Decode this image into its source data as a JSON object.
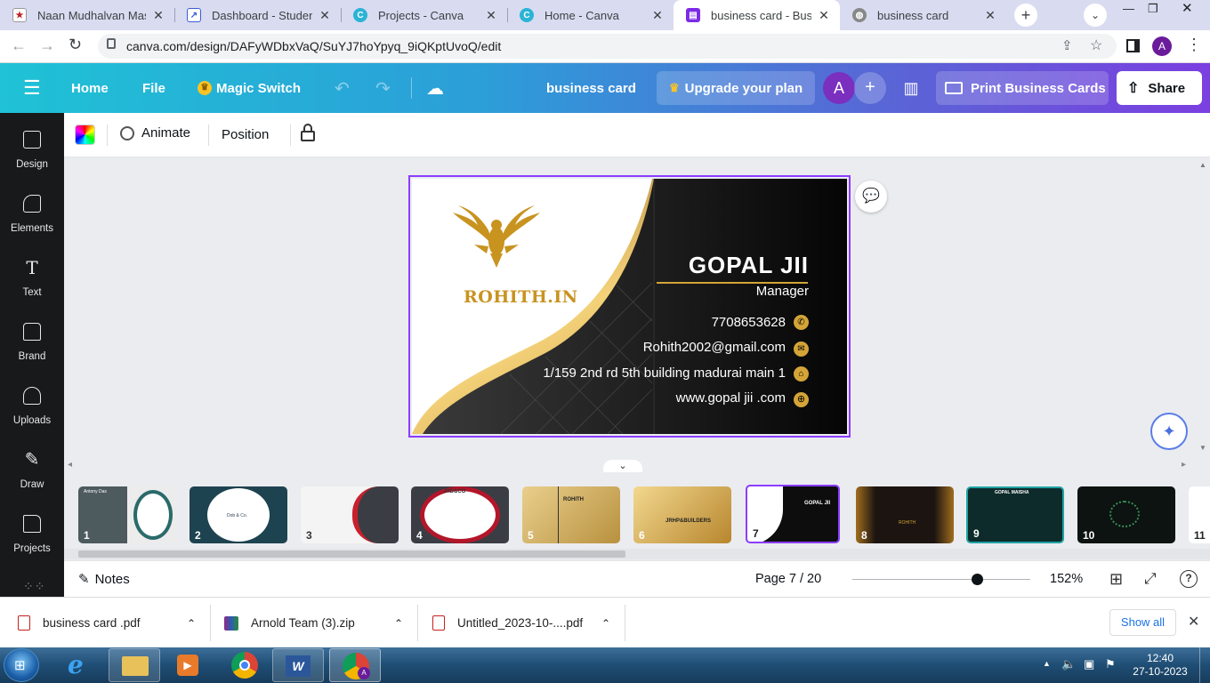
{
  "browser": {
    "tabs": [
      {
        "title": "Naan Mudhalvan Mass",
        "icon": "naan-mudhalvan-favicon",
        "active": false
      },
      {
        "title": "Dashboard - Student",
        "icon": "dashboard-favicon",
        "active": false
      },
      {
        "title": "Projects - Canva",
        "icon": "canva-favicon",
        "active": false
      },
      {
        "title": "Home - Canva",
        "icon": "canva-favicon",
        "active": false
      },
      {
        "title": "business card - Busines",
        "icon": "canva-doc-favicon",
        "active": true
      },
      {
        "title": "business card",
        "icon": "globe-favicon",
        "active": false
      }
    ],
    "url": "canva.com/design/DAFyWDbxVaQ/SuYJ7hoYpyq_9iQKptUvoQ/edit",
    "profile_initial": "A"
  },
  "canva_header": {
    "menu_icon": "hamburger-icon",
    "home": "Home",
    "file": "File",
    "magic_switch": "Magic Switch",
    "doc_title": "business card",
    "upgrade": "Upgrade your plan",
    "avatar_initial": "A",
    "print": "Print Business Cards",
    "share": "Share"
  },
  "sidebar": {
    "items": [
      {
        "label": "Design",
        "icon": "design-icon"
      },
      {
        "label": "Elements",
        "icon": "elements-icon"
      },
      {
        "label": "Text",
        "icon": "text-icon"
      },
      {
        "label": "Brand",
        "icon": "brand-icon"
      },
      {
        "label": "Uploads",
        "icon": "uploads-icon"
      },
      {
        "label": "Draw",
        "icon": "draw-icon"
      },
      {
        "label": "Projects",
        "icon": "projects-icon"
      }
    ]
  },
  "toolbar": {
    "animate": "Animate",
    "position": "Position"
  },
  "card": {
    "brand": "ROHITH.IN",
    "name": "GOPAL  JII",
    "role": "Manager",
    "phone": "7708653628",
    "email": "Rohith2002@gmail.com",
    "address": "1/159 2nd rd 5th building madurai main 1",
    "website": "www.gopal jii .com",
    "colors": {
      "gold": "#d4a437",
      "black": "#0a0a0a"
    }
  },
  "pages": {
    "thumbs": [
      {
        "num": "1",
        "bg": "#e9e9e9"
      },
      {
        "num": "2",
        "bg": "#1e4350"
      },
      {
        "num": "3",
        "bg": "#f4f4f4"
      },
      {
        "num": "4",
        "bg": "#b3162a"
      },
      {
        "num": "5",
        "bg": "#d9b86c"
      },
      {
        "num": "6",
        "bg": "#c9a04c"
      },
      {
        "num": "7",
        "bg": "#0d0d0d"
      },
      {
        "num": "8",
        "bg": "#1b1410"
      },
      {
        "num": "9",
        "bg": "#0d2b2b"
      },
      {
        "num": "10",
        "bg": "#0c1310"
      },
      {
        "num": "11",
        "bg": "#ffffff"
      }
    ],
    "thumb_text": {
      "t1": "Antony Das",
      "t2": "Dob & Co.",
      "t4": "JRD&CO",
      "t5": "ROHITH",
      "t6": "JRHP&BUILDERS",
      "t7": "GOPAL JII",
      "t8": "ROHITH",
      "t9": "GOPAL MAISHA"
    }
  },
  "bottombar": {
    "notes": "Notes",
    "page": "Page 7 / 20",
    "zoom": "152%",
    "zoom_level": 0.7
  },
  "downloads": {
    "items": [
      "business card .pdf",
      "Arnold Team (3).zip",
      "Untitled_2023-10-....pdf"
    ],
    "show_all": "Show all"
  },
  "taskbar": {
    "time": "12:40",
    "date": "27-10-2023"
  }
}
